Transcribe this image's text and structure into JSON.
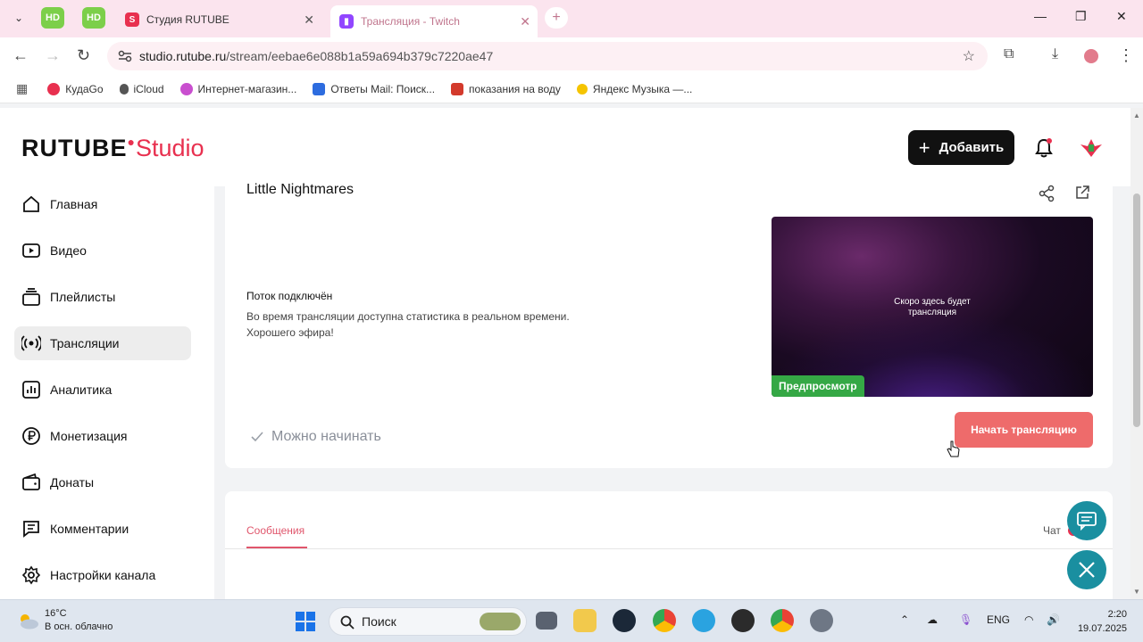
{
  "browser": {
    "tabs": [
      {
        "label": "Студия RUTUBE",
        "active": false
      },
      {
        "label": "Трансляция - Twitch",
        "active": true
      }
    ],
    "hd_badge": "HD",
    "url_host": "studio.rutube.ru",
    "url_path": "/stream/eebae6e088b1a59a694b379c7220ae47",
    "bookmarks": [
      {
        "label": "КудаGo",
        "color": "#e8304f"
      },
      {
        "label": "iCloud",
        "color": "#555555"
      },
      {
        "label": "Интернет-магазин...",
        "color": "#c94fcf"
      },
      {
        "label": "Ответы Mail: Поиск...",
        "color": "#2d6cdf"
      },
      {
        "label": "показания на воду",
        "color": "#d33a2c"
      },
      {
        "label": "Яндекс Музыка —...",
        "color": "#f5c400"
      }
    ]
  },
  "app": {
    "logo_main": "RUTUBE",
    "logo_studio": "Studio",
    "add_button": "Добавить",
    "accent_color": "#e8304f",
    "sidebar": [
      {
        "label": "Главная",
        "icon": "home-icon"
      },
      {
        "label": "Видео",
        "icon": "video-icon"
      },
      {
        "label": "Плейлисты",
        "icon": "playlist-icon"
      },
      {
        "label": "Трансляции",
        "icon": "broadcast-icon",
        "active": true
      },
      {
        "label": "Аналитика",
        "icon": "analytics-icon"
      },
      {
        "label": "Монетизация",
        "icon": "ruble-icon"
      },
      {
        "label": "Донаты",
        "icon": "wallet-icon"
      },
      {
        "label": "Комментарии",
        "icon": "comments-icon"
      },
      {
        "label": "Настройки канала",
        "icon": "gear-icon"
      }
    ],
    "stream": {
      "title": "Little Nightmares",
      "status_title": "Поток подключён",
      "status_line1": "Во время трансляции доступна статистика в реальном времени.",
      "status_line2": "Хорошего эфира!",
      "preview_text_line1": "Скоро здесь будет",
      "preview_text_line2": "трансляция",
      "preview_badge": "Предпросмотр",
      "ready_text": "Можно начинать",
      "start_button": "Начать трансляцию"
    },
    "chat": {
      "tab_messages": "Сообщения",
      "chat_label": "Чат"
    }
  },
  "taskbar": {
    "temperature": "16°C",
    "weather": "В осн. облачно",
    "search_placeholder": "Поиск",
    "language": "ENG",
    "time": "2:20",
    "date": "19.07.2025"
  }
}
